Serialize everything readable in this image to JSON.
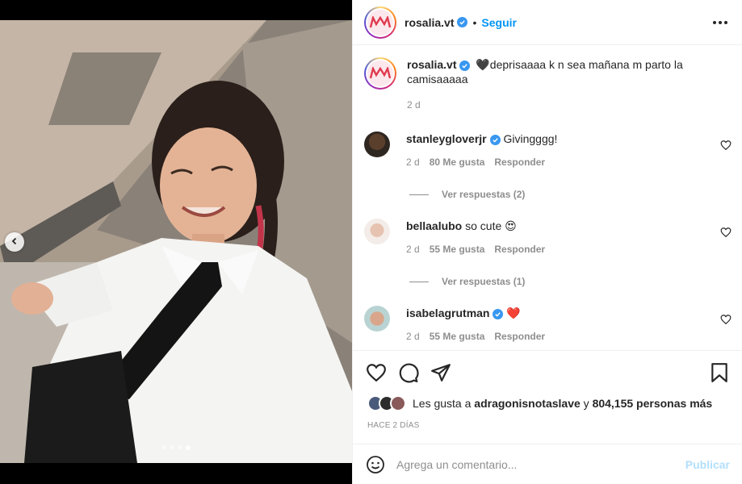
{
  "post": {
    "username": "rosalia.vt",
    "follow_label": "Seguir",
    "bullet": "•",
    "caption_text": "🖤deprisaaaa k n sea mañana m parto la camisaaaaa",
    "caption_age": "2 d",
    "carousel": {
      "total": 4,
      "active_index": 3
    }
  },
  "comments": [
    {
      "username": "stanleygloverjr",
      "text": "Givingggg!",
      "age": "2 d",
      "likes": "80 Me gusta",
      "reply": "Responder",
      "view_replies": "Ver respuestas (2)"
    },
    {
      "username": "bellaalubo",
      "text": "so cute 😍",
      "age": "2 d",
      "likes": "55 Me gusta",
      "reply": "Responder",
      "view_replies": "Ver respuestas (1)"
    },
    {
      "username": "isabelagrutman",
      "text": "❤️",
      "age": "2 d",
      "likes": "55 Me gusta",
      "reply": "Responder"
    }
  ],
  "likes": {
    "prefix": "Les gusta a",
    "user": "adragonisnotaslave",
    "middle": "y",
    "count": "804,155 personas más"
  },
  "timestamp": "HACE 2 DÍAS",
  "composer": {
    "placeholder": "Agrega un comentario...",
    "post_label": "Publicar"
  },
  "icons": {
    "verified": "verified-badge-icon",
    "more": "more-options-icon",
    "heart": "heart-icon",
    "comment": "comment-icon",
    "share": "share-icon",
    "save": "bookmark-icon",
    "emoji": "emoji-icon",
    "carousel_prev": "chevron-left-icon"
  },
  "colors": {
    "accent": "#0095f6",
    "verified": "#3897f0",
    "muted": "#8e8e8e",
    "publish_disabled": "#b2dffc"
  }
}
